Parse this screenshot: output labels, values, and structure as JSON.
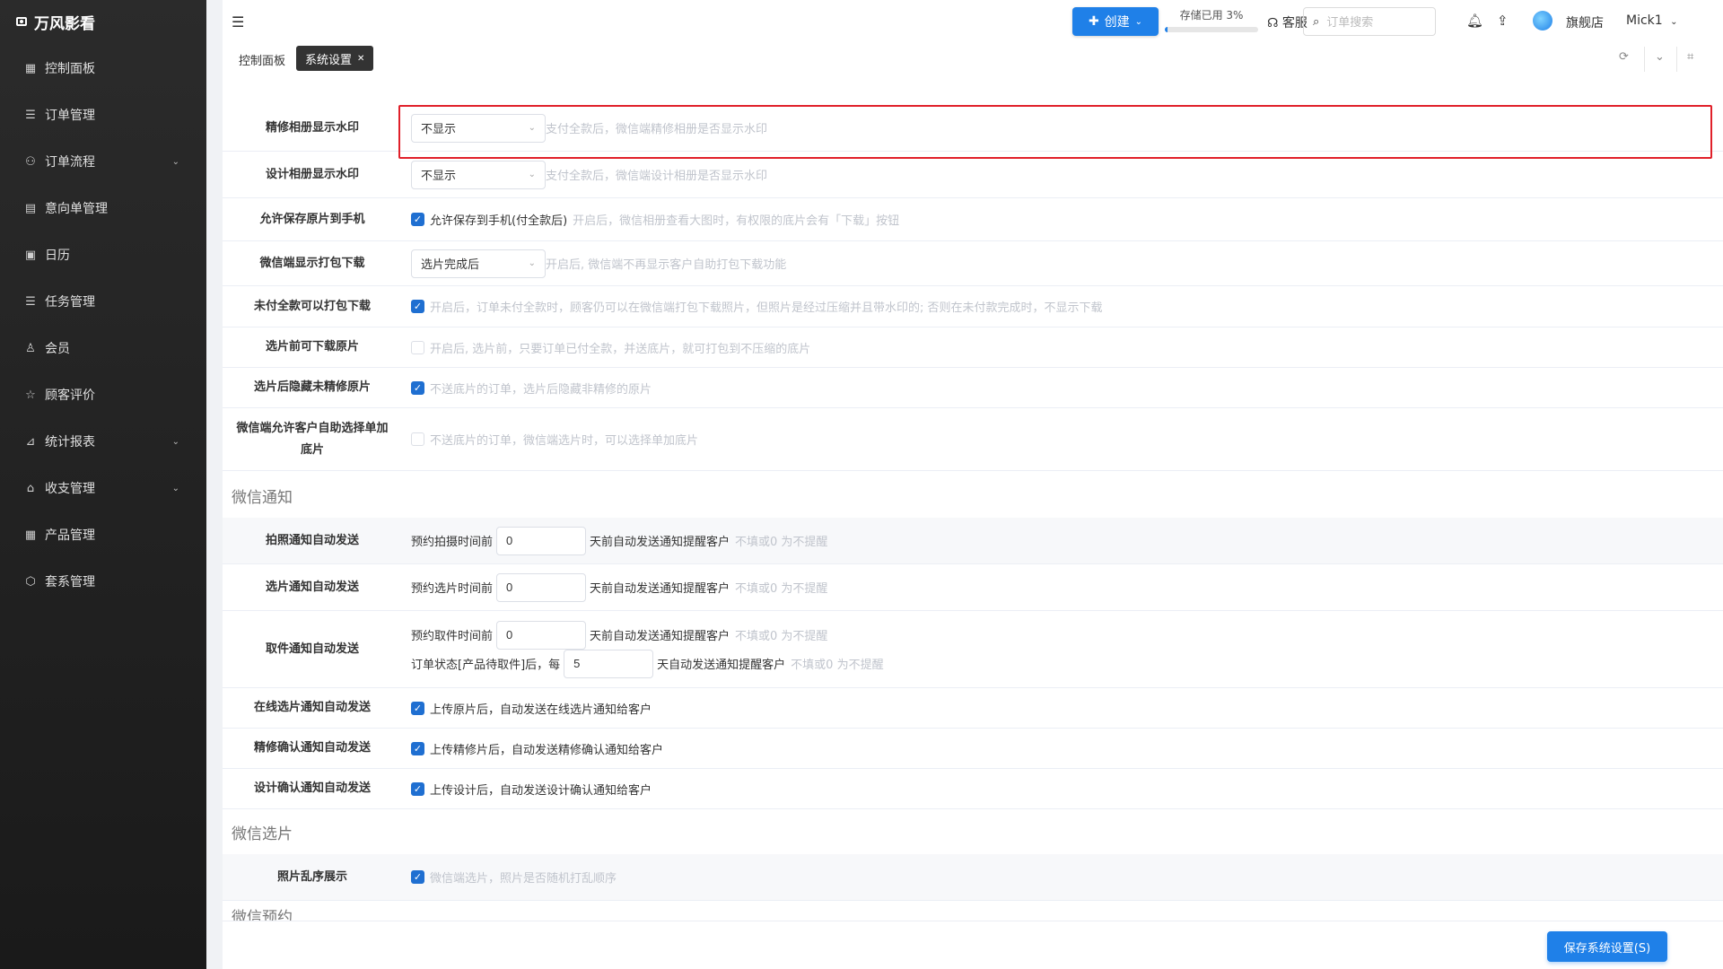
{
  "app": {
    "name": "万风影看"
  },
  "sidebar": {
    "items": [
      {
        "label": "控制面板",
        "icon": "grid-icon",
        "glyph": "▦",
        "chevron": false
      },
      {
        "label": "订单管理",
        "icon": "list-icon",
        "glyph": "☰",
        "chevron": false
      },
      {
        "label": "订单流程",
        "icon": "flow-icon",
        "glyph": "⚇",
        "chevron": true
      },
      {
        "label": "意向单管理",
        "icon": "document-icon",
        "glyph": "▤",
        "chevron": false
      },
      {
        "label": "日历",
        "icon": "calendar-icon",
        "glyph": "▣",
        "chevron": false
      },
      {
        "label": "任务管理",
        "icon": "task-list-icon",
        "glyph": "☰",
        "chevron": false
      },
      {
        "label": "会员",
        "icon": "user-icon",
        "glyph": "♙",
        "chevron": false
      },
      {
        "label": "顾客评价",
        "icon": "star-icon",
        "glyph": "☆",
        "chevron": false
      },
      {
        "label": "统计报表",
        "icon": "chart-icon",
        "glyph": "⊿",
        "chevron": true
      },
      {
        "label": "收支管理",
        "icon": "bank-icon",
        "glyph": "⌂",
        "chevron": true
      },
      {
        "label": "产品管理",
        "icon": "product-grid-icon",
        "glyph": "▦",
        "chevron": false
      },
      {
        "label": "套系管理",
        "icon": "package-icon",
        "glyph": "⬡",
        "chevron": false
      }
    ]
  },
  "topbar": {
    "create_label": "创建",
    "storage_label": "存储已用 3%",
    "storage_percent": 3,
    "service_label": "客服",
    "search_placeholder": "订单搜索",
    "store_name": "旗舰店",
    "user_name": "Mick1"
  },
  "tabs": [
    {
      "label": "控制面板",
      "active": false
    },
    {
      "label": "系统设置",
      "active": true
    }
  ],
  "settings": {
    "retouch_watermark": {
      "label": "精修相册显示水印",
      "value": "不显示",
      "hint": "支付全款后，微信端精修相册是否显示水印"
    },
    "design_watermark": {
      "label": "设计相册显示水印",
      "value": "不显示",
      "hint": "支付全款后，微信端设计相册是否显示水印"
    },
    "save_original": {
      "label": "允许保存原片到手机",
      "checked": true,
      "text": "允许保存到手机(付全款后)",
      "hint": "开启后，微信相册查看大图时，有权限的底片会有「下载」按钮"
    },
    "pack_download": {
      "label": "微信端显示打包下载",
      "value": "选片完成后",
      "hint": "开启后, 微信端不再显示客户自助打包下载功能"
    },
    "unpaid_pack": {
      "label": "未付全款可以打包下载",
      "checked": true,
      "hint": "开启后，订单未付全款时，顾客仍可以在微信端打包下载照片，但照片是经过压缩并且带水印的; 否则在未付款完成时，不显示下载"
    },
    "pre_select_download": {
      "label": "选片前可下载原片",
      "checked": false,
      "hint": "开启后, 选片前，只要订单已付全款，并送底片，就可打包到不压缩的底片"
    },
    "hide_unretouched": {
      "label": "选片后隐藏未精修原片",
      "checked": true,
      "hint": "不送底片的订单，选片后隐藏非精修的原片"
    },
    "self_add_negative": {
      "label": "微信端允许客户自助选择单加底片",
      "checked": false,
      "hint": "不送底片的订单，微信端选片时，可以选择单加底片"
    }
  },
  "section_notify": "微信通知",
  "notify": {
    "shoot": {
      "label": "拍照通知自动发送",
      "prefix": "预约拍摄时间前",
      "value": "0",
      "suffix": "天前自动发送通知提醒客户",
      "hint": "不填或0 为不提醒"
    },
    "select": {
      "label": "选片通知自动发送",
      "prefix": "预约选片时间前",
      "value": "0",
      "suffix": "天前自动发送通知提醒客户",
      "hint": "不填或0 为不提醒"
    },
    "pickup": {
      "label": "取件通知自动发送",
      "prefix": "预约取件时间前",
      "value": "0",
      "suffix": "天前自动发送通知提醒客户",
      "hint": "不填或0 为不提醒",
      "prefix2": "订单状态[产品待取件]后，每",
      "value2": "5",
      "suffix2": "天自动发送通知提醒客户",
      "hint2": "不填或0 为不提醒"
    },
    "online_select": {
      "label": "在线选片通知自动发送",
      "checked": true,
      "text": "上传原片后，自动发送在线选片通知给客户"
    },
    "retouch_confirm": {
      "label": "精修确认通知自动发送",
      "checked": true,
      "text": "上传精修片后，自动发送精修确认通知给客户"
    },
    "design_confirm": {
      "label": "设计确认通知自动发送",
      "checked": true,
      "text": "上传设计后，自动发送设计确认通知给客户"
    }
  },
  "section_select": "微信选片",
  "shuffle": {
    "label": "照片乱序展示",
    "checked": true,
    "hint": "微信端选片，照片是否随机打乱顺序"
  },
  "section_booking": "微信预约",
  "save_label": "保存系统设置(S)"
}
